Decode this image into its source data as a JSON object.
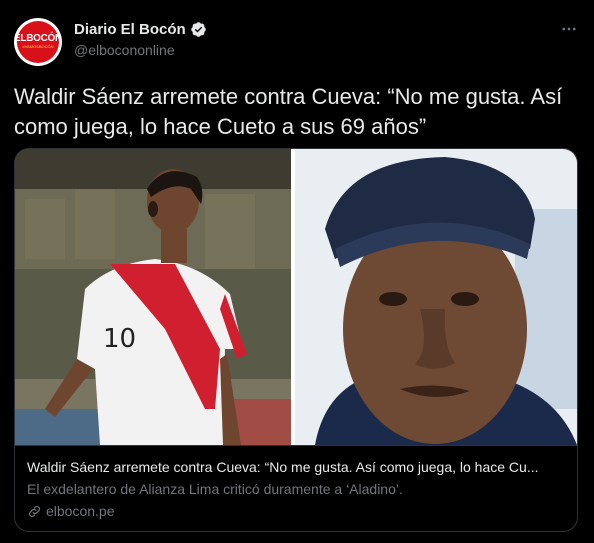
{
  "tweet": {
    "avatar": {
      "brand_text": "ELBOCÓN",
      "tagline": "#VAMOSBOCÓN"
    },
    "display_name": "Diario El Bocón",
    "handle": "@elbocononline",
    "more_icon": "more-horizontal-icon",
    "verified_icon": "verified-badge-icon",
    "text": "Waldir Sáenz arremete contra Cueva: “No me gusta. Así como juega, lo hace Cueto a sus 69 años”"
  },
  "card": {
    "title": "Waldir Sáenz arremete contra Cueva: “No me gusta. Así como juega, lo hace Cu...",
    "description": "El exdelantero de Alianza Lima criticó duramente a ‘Aladino’.",
    "domain": "elbocon.pe",
    "link_icon": "link-icon",
    "image": {
      "jersey_number": "10"
    }
  },
  "colors": {
    "background": "#000000",
    "text_primary": "#e7e9ea",
    "text_secondary": "#71767b",
    "border": "#2f3336",
    "verified": "#1d9bf0",
    "brand_red": "#d8101a"
  }
}
